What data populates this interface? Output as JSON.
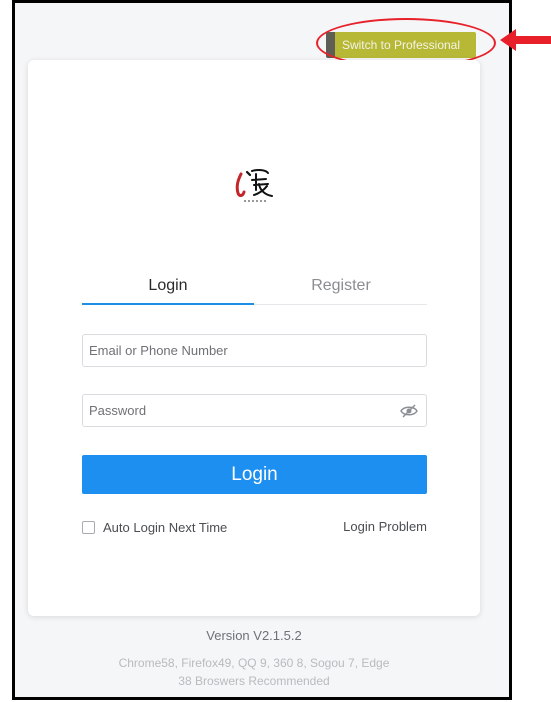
{
  "header": {
    "switch_label": "Switch to Professional"
  },
  "tabs": {
    "login": "Login",
    "register": "Register"
  },
  "form": {
    "email_placeholder": "Email or Phone Number",
    "email_value": "",
    "password_placeholder": "Password",
    "password_value": "",
    "submit_label": "Login",
    "auto_login_label": "Auto Login Next Time",
    "auto_login_checked": false,
    "login_problem_label": "Login Problem"
  },
  "footer": {
    "version": "Version V2.1.5.2",
    "browsers_line1": "Chrome58, Firefox49, QQ 9, 360 8, Sogou 7, Edge",
    "browsers_line2": "38 Broswers Recommended"
  },
  "icons": {
    "logo": "brand-logo-icon",
    "password_toggle": "eye-hidden-icon",
    "annotation_arrow": "red-arrow-icon"
  },
  "colors": {
    "accent": "#1d8ff0",
    "annotation": "#e8202a",
    "highlight": "#c8c832"
  }
}
